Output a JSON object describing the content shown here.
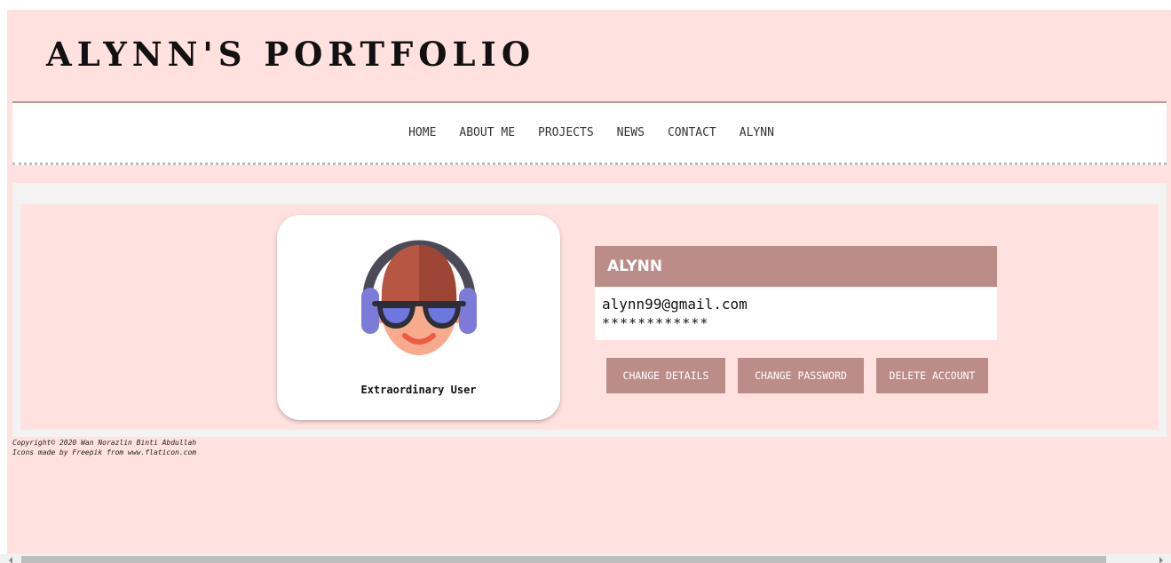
{
  "header": {
    "title": "ALYNN'S PORTFOLIO"
  },
  "nav": {
    "items": [
      {
        "label": "HOME"
      },
      {
        "label": "ABOUT ME"
      },
      {
        "label": "PROJECTS"
      },
      {
        "label": "NEWS"
      },
      {
        "label": "CONTACT"
      },
      {
        "label": "ALYNN"
      }
    ]
  },
  "profile": {
    "avatar_icon": "user-avatar-headphones-sunglasses-icon",
    "role": "Extraordinary User"
  },
  "account": {
    "name": "ALYNN",
    "email": "alynn99@gmail.com",
    "password_masked": "************",
    "buttons": {
      "change_details": "CHANGE DETAILS",
      "change_password": "CHANGE PASSWORD",
      "delete_account": "DELETE ACCOUNT"
    }
  },
  "footer": {
    "copyright": "Copyright© 2020 Wan Norazlin Binti Abdullah",
    "credit": "Icons made by Freepik from www.flaticon.com"
  },
  "colors": {
    "page_background": "#ffe2df",
    "accent": "#bc8c89",
    "nav_background": "#ffffff",
    "content_frame": "#f3f3f3"
  }
}
